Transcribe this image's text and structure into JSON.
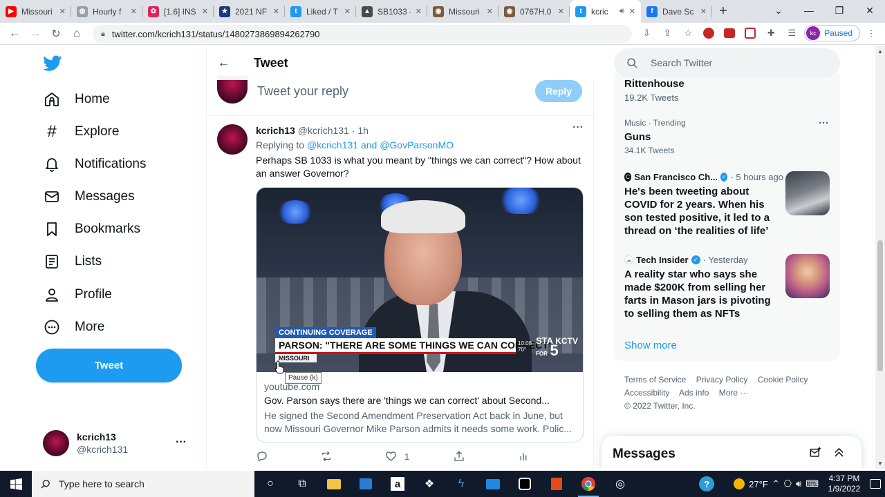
{
  "browser": {
    "tabs": [
      {
        "label": "Missouri",
        "favicon_color": "#ff0000",
        "favicon_icon": "youtube-icon"
      },
      {
        "label": "Hourly f",
        "favicon_color": "#9aa0a6",
        "favicon_icon": "globe-icon"
      },
      {
        "label": "[1.6] INS",
        "favicon_color": "#e0245e",
        "favicon_icon": "app-icon"
      },
      {
        "label": "2021 NF",
        "favicon_color": "#1a3a7a",
        "favicon_icon": "nfl-icon"
      },
      {
        "label": "Liked / T",
        "favicon_color": "#1d9bf0",
        "favicon_icon": "twitter-icon"
      },
      {
        "label": "SB1033 -",
        "favicon_color": "#4a4a4a",
        "favicon_icon": "document-icon"
      },
      {
        "label": "Missouri",
        "favicon_color": "#7a5c3a",
        "favicon_icon": "seal-icon"
      },
      {
        "label": "0767H.0",
        "favicon_color": "#7a5c3a",
        "favicon_icon": "seal-icon"
      },
      {
        "label": "kcric",
        "favicon_color": "#1d9bf0",
        "favicon_icon": "twitter-icon",
        "active": true
      },
      {
        "label": "Dave Sc",
        "favicon_color": "#1877f2",
        "favicon_icon": "facebook-icon"
      }
    ],
    "url": "twitter.com/kcrich131/status/1480273869894262790",
    "profile_initials": "kc",
    "profile_status": "Paused"
  },
  "nav": {
    "items": [
      {
        "label": "Home",
        "icon": "home-icon"
      },
      {
        "label": "Explore",
        "icon": "hashtag-icon"
      },
      {
        "label": "Notifications",
        "icon": "bell-icon"
      },
      {
        "label": "Messages",
        "icon": "envelope-icon"
      },
      {
        "label": "Bookmarks",
        "icon": "bookmark-icon"
      },
      {
        "label": "Lists",
        "icon": "list-icon"
      },
      {
        "label": "Profile",
        "icon": "person-icon"
      },
      {
        "label": "More",
        "icon": "more-circle-icon"
      }
    ],
    "tweet_button": "Tweet",
    "account": {
      "name": "kcrich13",
      "handle": "@kcrich131"
    }
  },
  "main": {
    "title": "Tweet",
    "composer": {
      "placeholder": "Tweet your reply",
      "reply_button": "Reply"
    },
    "tweet": {
      "name": "kcrich13",
      "handle": "@kcrich131",
      "time": "1h",
      "replying_prefix": "Replying to",
      "replying_to": "@kcrich131 and @GovParsonMO",
      "text": "Perhaps SB 1033 is what you meant by \"things we can correct\"? How about an answer Governor?",
      "video": {
        "banner_tag": "CONTINUING COVERAGE",
        "headline": "PARSON: \"THERE ARE SOME THINGS WE CAN CORRECT\"",
        "location": "MISSOURI",
        "clock_time": "10:08",
        "clock_temp": "70°",
        "station": "KCTV",
        "station_num": "5",
        "station_prefix": "STA",
        "station_sub": "FOR",
        "tooltip": "Pause (k)"
      },
      "card": {
        "domain": "youtube.com",
        "title": "Gov. Parson says there are 'things we can correct' about Second...",
        "description": "He signed the Second Amendment Preservation Act back in June, but now Missouri Governor Mike Parson admits it needs some work. Polic..."
      },
      "likes": "1"
    }
  },
  "sidebar": {
    "search_placeholder": "Search Twitter",
    "trends": [
      {
        "title": "Rittenhouse",
        "count": "19.2K Tweets"
      },
      {
        "category": "Music · Trending",
        "title": "Guns",
        "count": "34.1K Tweets"
      }
    ],
    "news": [
      {
        "source": "San Francisco Ch...",
        "time": "· 5 hours ago",
        "headline": "He's been tweeting about COVID for 2 years. When his son tested positive, it led to a thread on ‘the realities of life’"
      },
      {
        "source": "Tech Insider",
        "time": "· Yesterday",
        "headline": "A reality star who says she made $200K from selling her farts in Mason jars is pivoting to selling them as NFTs"
      }
    ],
    "show_more": "Show more",
    "footer_links": [
      "Terms of Service",
      "Privacy Policy",
      "Cookie Policy",
      "Accessibility",
      "Ads info",
      "More ···"
    ],
    "copyright": "© 2022 Twitter, Inc.",
    "messages_title": "Messages"
  },
  "taskbar": {
    "search_placeholder": "Type here to search",
    "temperature": "27°F",
    "time": "4:37 PM",
    "date": "1/9/2022"
  },
  "colors": {
    "twitter_blue": "#1d9bf0",
    "text_dark": "#0f1419",
    "text_muted": "#536471",
    "reply_disabled": "#8ecdf8"
  }
}
